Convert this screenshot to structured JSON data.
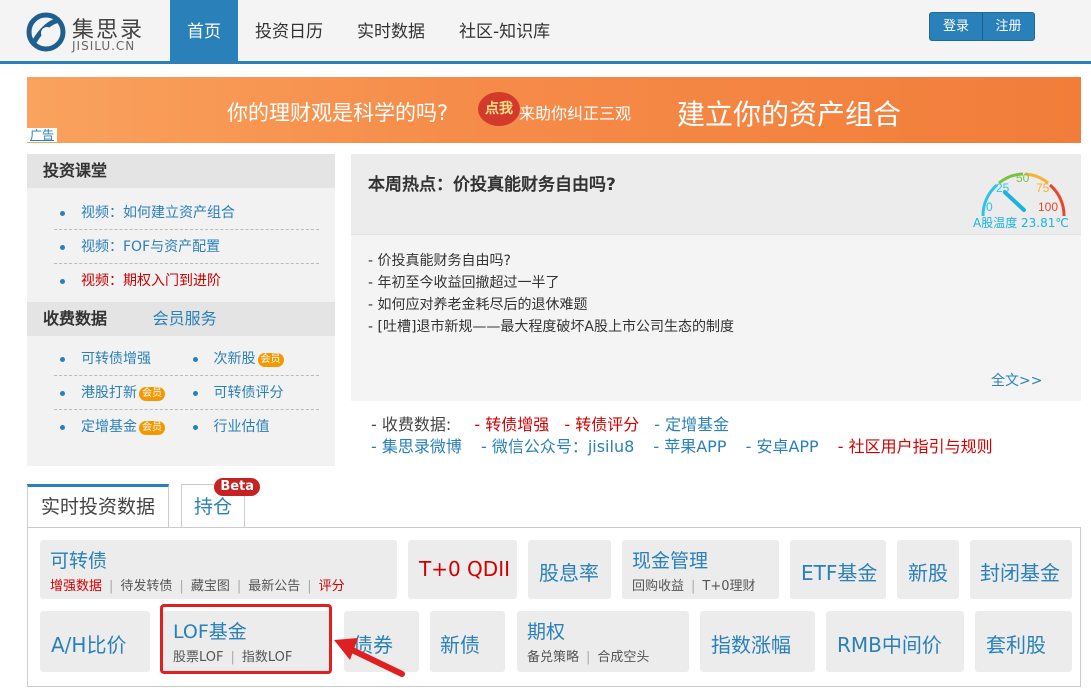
{
  "header": {
    "logo_cn": "集思录",
    "logo_en": "JISILU.CN",
    "nav": [
      {
        "label": "首页",
        "active": true
      },
      {
        "label": "投资日历",
        "active": false
      },
      {
        "label": "实时数据",
        "active": false
      },
      {
        "label": "社区-知识库",
        "active": false
      }
    ],
    "login_label": "登录",
    "register_label": "注册",
    "accent_color": "#2a80b9"
  },
  "banner": {
    "text1": "你的理财观是科学的吗?",
    "badge": "点我",
    "text2": "来助你纠正三观",
    "text3": "建立你的资产组合",
    "ad_label": "广告"
  },
  "left_panel": {
    "course_title": "投资课堂",
    "courses": [
      {
        "label": "视频：如何建立资产组合"
      },
      {
        "label": "视频：FOF与资产配置"
      },
      {
        "label": "视频：期权入门到进阶"
      }
    ],
    "paid_title": "收费数据",
    "member_service": "会员服务",
    "vip_badge": "会员",
    "paid_items": [
      {
        "label": "可转债增强"
      },
      {
        "label": "次新股"
      },
      {
        "label": "港股打新"
      },
      {
        "label": "可转债评分"
      },
      {
        "label": "定增基金"
      },
      {
        "label": "行业估值"
      }
    ]
  },
  "hot": {
    "title": "本周热点：价投真能财务自由吗?",
    "gauge": {
      "label": "A股温度 23.81℃",
      "ticks": [
        "0",
        "25",
        "50",
        "75",
        "100"
      ],
      "value": 23.81
    },
    "items": [
      "- 价投真能财务自由吗?",
      "- 年初至今收益回撤超过一半了",
      "- 如何应对养老金耗尽后的退休难题",
      "- [吐槽]退市新规——最大程度破坏A股上市公司生态的制度"
    ],
    "more": "全文>>",
    "links_row1": {
      "lead": "- 收费数据:",
      "items": [
        "- 转债增强",
        "- 转债评分",
        "- 定增基金"
      ]
    },
    "links_row2": [
      "- 集思录微博",
      "- 微信公众号：jisilu8",
      "- 苹果APP",
      "- 安卓APP",
      "- 社区用户指引与规则"
    ]
  },
  "tabs": {
    "realtime": "实时投资数据",
    "holding": "持仓",
    "beta": "Beta"
  },
  "cards": {
    "convertible": {
      "title": "可转债",
      "subs": [
        "增强数据",
        "待发转债",
        "藏宝图",
        "最新公告",
        "评分"
      ]
    },
    "t0qdii": "T+0 QDII",
    "dividend": "股息率",
    "cash": {
      "title": "现金管理",
      "subs": [
        "回购收益",
        "T+0理财"
      ]
    },
    "etf": "ETF基金",
    "ipo": "新股",
    "closed_fund": "封闭基金",
    "ah": "A/H比价",
    "lof": {
      "title": "LOF基金",
      "subs": [
        "股票LOF",
        "指数LOF"
      ]
    },
    "bond": "债券",
    "new_bond": "新债",
    "options": {
      "title": "期权",
      "subs": [
        "备兑策略",
        "合成空头"
      ]
    },
    "index_rise": "指数涨幅",
    "rmb": "RMB中间价",
    "arbitrage": "套利股"
  }
}
